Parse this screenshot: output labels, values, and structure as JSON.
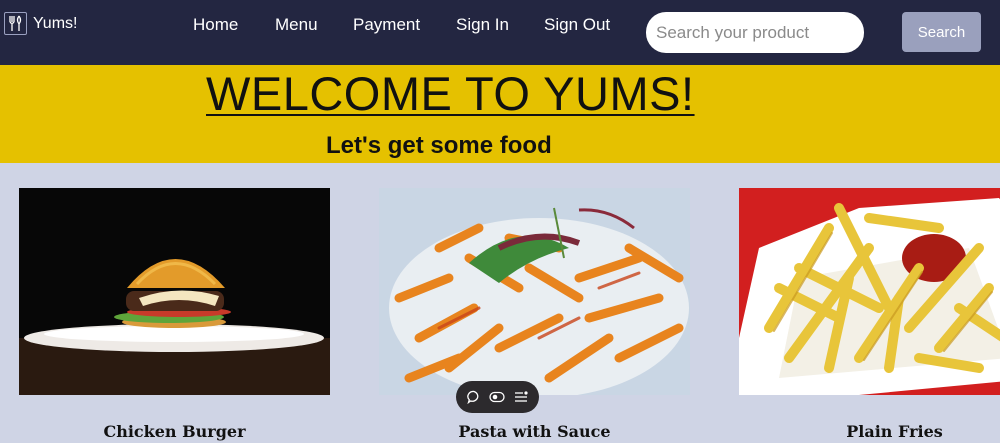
{
  "brand": {
    "name": "Yums!",
    "logo_icon": "fork-knife-icon"
  },
  "nav": {
    "links": [
      {
        "label": "Home"
      },
      {
        "label": "Menu"
      },
      {
        "label": "Payment"
      },
      {
        "label": "Sign In"
      },
      {
        "label": "Sign Out"
      }
    ]
  },
  "search": {
    "placeholder": "Search your product",
    "value": "",
    "button_label": "Search"
  },
  "hero": {
    "title": "WELCOME TO YUMS!",
    "subtitle": "Let's get some food"
  },
  "products": [
    {
      "title": "Chicken Burger"
    },
    {
      "title": "Pasta with Sauce"
    },
    {
      "title": "Plain Fries"
    }
  ],
  "toolbar": {
    "icons": [
      "comment-icon",
      "toggle-icon",
      "list-icon"
    ]
  },
  "colors": {
    "navbar_bg": "#232641",
    "hero_bg": "#e5c100",
    "page_bg": "#cfd4e5",
    "search_button_bg": "#9aa0bd"
  }
}
